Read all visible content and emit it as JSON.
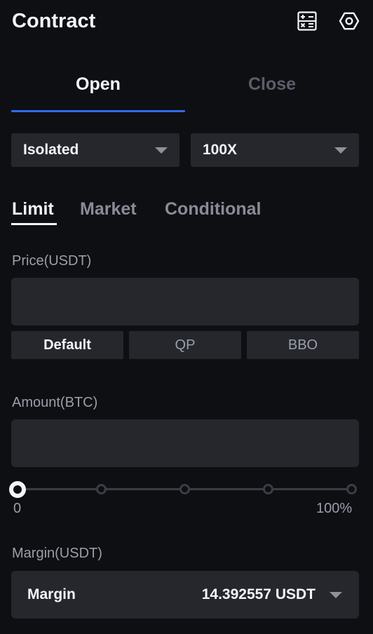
{
  "header": {
    "title": "Contract",
    "icons": [
      "calculator-icon",
      "settings-icon"
    ]
  },
  "position_tabs": {
    "open": "Open",
    "close": "Close",
    "active": "Open"
  },
  "margin_mode": {
    "selected": "Isolated"
  },
  "leverage": {
    "selected": "100X"
  },
  "order_types": {
    "items": [
      "Limit",
      "Market",
      "Conditional"
    ],
    "active": "Limit"
  },
  "price": {
    "label": "Price(USDT)",
    "value": "",
    "buttons": [
      "Default",
      "QP",
      "BBO"
    ],
    "active_button": "Default"
  },
  "amount": {
    "label": "Amount(BTC)",
    "value": "",
    "slider_percent": 0,
    "min_label": "0",
    "max_label": "100%"
  },
  "margin": {
    "label": "Margin(USDT)",
    "name": "Margin",
    "value": "14.392557 USDT"
  },
  "colors": {
    "accent": "#2f6bf0",
    "background": "#0e0f13",
    "surface": "#25272d"
  }
}
